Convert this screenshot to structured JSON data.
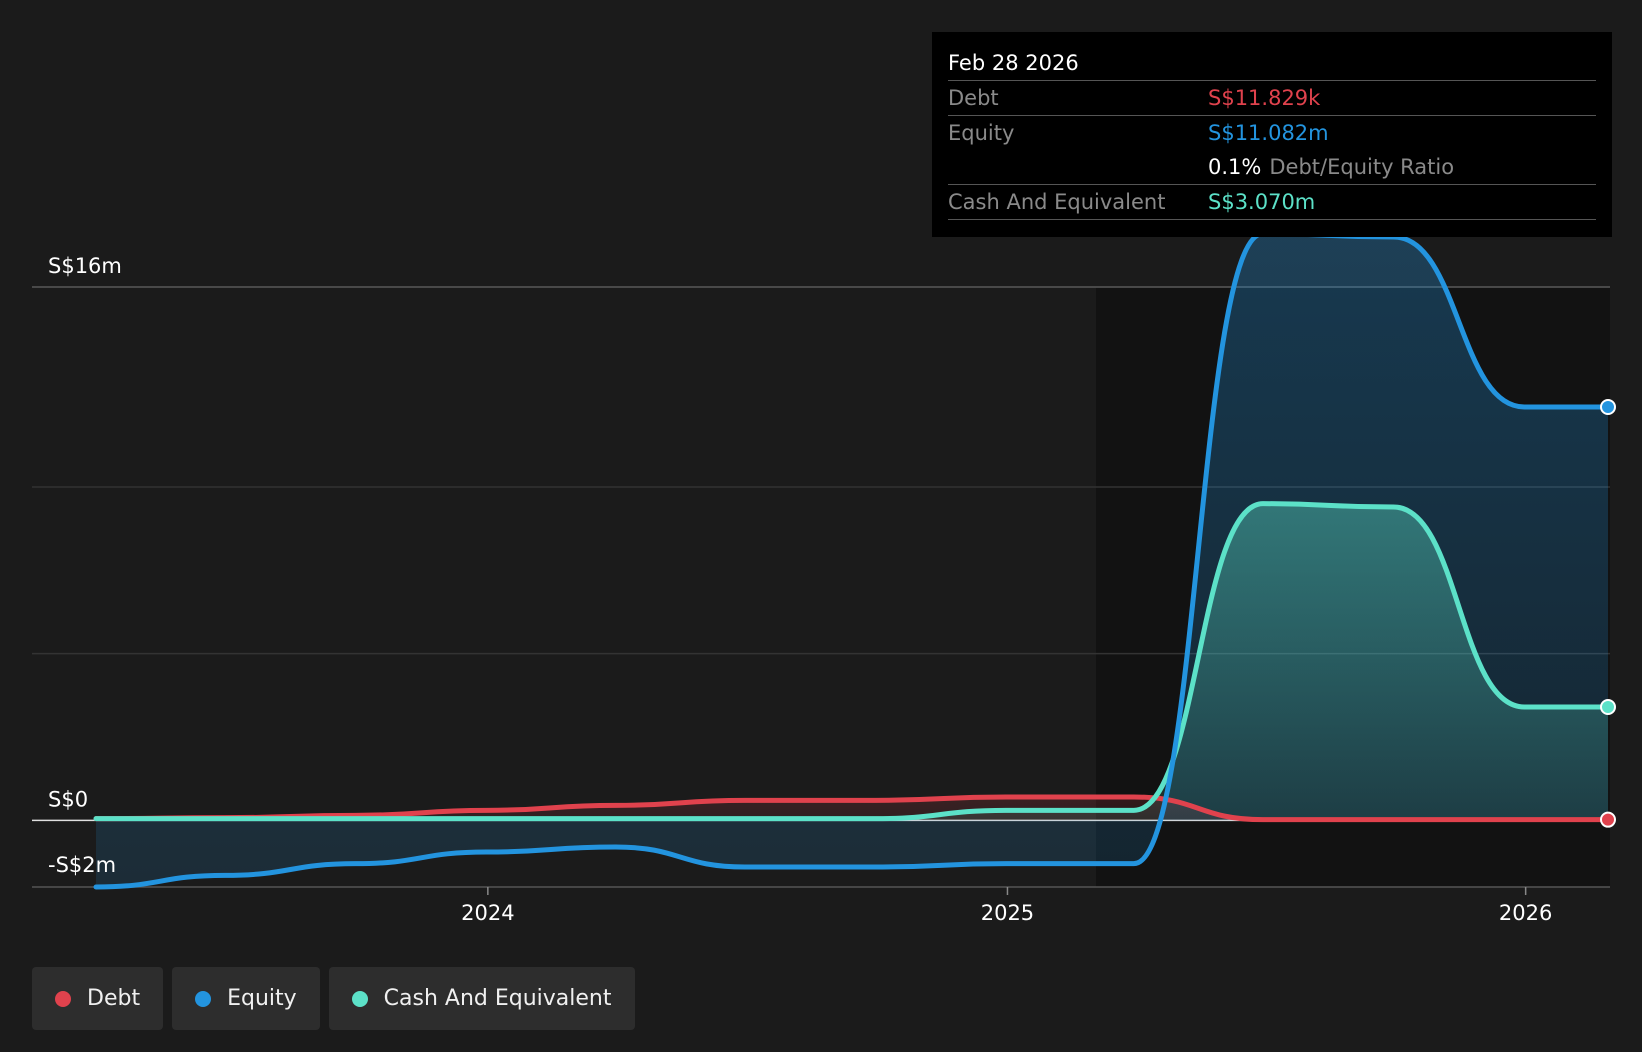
{
  "tooltip": {
    "date": "Feb 28 2026",
    "rows": [
      {
        "label": "Debt",
        "value": "S$11.829k",
        "color": "#e0424d"
      },
      {
        "label": "Equity",
        "value": "S$11.082m",
        "color": "#2394df"
      },
      {
        "label": "Cash And Equivalent",
        "value": "S$3.070m",
        "color": "#5ce1c8"
      }
    ],
    "ratio_value": "0.1%",
    "ratio_label": "Debt/Equity Ratio"
  },
  "legend": [
    {
      "label": "Debt",
      "color": "#e0424d"
    },
    {
      "label": "Equity",
      "color": "#2394df"
    },
    {
      "label": "Cash And Equivalent",
      "color": "#5ce1c8"
    }
  ],
  "chart_data": {
    "type": "area",
    "y_tick_labels": [
      {
        "value": 16,
        "label": "S$16m"
      },
      {
        "value": 0,
        "label": "S$0"
      },
      {
        "value": -2,
        "label": "-S$2m"
      }
    ],
    "ylim": [
      -2,
      16
    ],
    "xlim": [
      "2023-03-31",
      "2026-02-28"
    ],
    "x_ticks": [
      {
        "date": "2024-01-01",
        "label": "2024"
      },
      {
        "date": "2025-01-01",
        "label": "2025"
      },
      {
        "date": "2026-01-01",
        "label": "2026"
      }
    ],
    "grid": true,
    "series": [
      {
        "name": "Debt",
        "color": "#e0424d",
        "points": [
          [
            "2023-03-31",
            0.05
          ],
          [
            "2023-06-30",
            0.08
          ],
          [
            "2023-09-30",
            0.15
          ],
          [
            "2023-12-31",
            0.3
          ],
          [
            "2024-03-31",
            0.45
          ],
          [
            "2024-06-30",
            0.6
          ],
          [
            "2024-09-30",
            0.6
          ],
          [
            "2024-12-31",
            0.7
          ],
          [
            "2025-03-31",
            0.7
          ],
          [
            "2025-06-30",
            0.02
          ],
          [
            "2025-09-30",
            0.02
          ],
          [
            "2025-12-31",
            0.02
          ],
          [
            "2026-02-28",
            0.02
          ]
        ]
      },
      {
        "name": "Equity",
        "color": "#2394df",
        "points": [
          [
            "2023-03-31",
            -2.0
          ],
          [
            "2023-06-30",
            -1.65
          ],
          [
            "2023-09-30",
            -1.3
          ],
          [
            "2023-12-31",
            -0.95
          ],
          [
            "2024-03-31",
            -0.8
          ],
          [
            "2024-06-30",
            -1.4
          ],
          [
            "2024-09-30",
            -1.4
          ],
          [
            "2024-12-31",
            -1.3
          ],
          [
            "2025-03-31",
            -1.3
          ],
          [
            "2025-06-30",
            17.6
          ],
          [
            "2025-09-30",
            17.5
          ],
          [
            "2025-12-31",
            12.4
          ],
          [
            "2026-02-28",
            12.4
          ]
        ]
      },
      {
        "name": "Cash And Equivalent",
        "color": "#5ce1c8",
        "points": [
          [
            "2023-03-31",
            0.05
          ],
          [
            "2023-06-30",
            0.05
          ],
          [
            "2023-09-30",
            0.05
          ],
          [
            "2023-12-31",
            0.05
          ],
          [
            "2024-03-31",
            0.05
          ],
          [
            "2024-06-30",
            0.05
          ],
          [
            "2024-09-30",
            0.05
          ],
          [
            "2024-12-31",
            0.3
          ],
          [
            "2025-03-31",
            0.3
          ],
          [
            "2025-06-30",
            9.5
          ],
          [
            "2025-09-30",
            9.4
          ],
          [
            "2025-12-31",
            3.4
          ],
          [
            "2026-02-28",
            3.4
          ]
        ]
      }
    ]
  }
}
